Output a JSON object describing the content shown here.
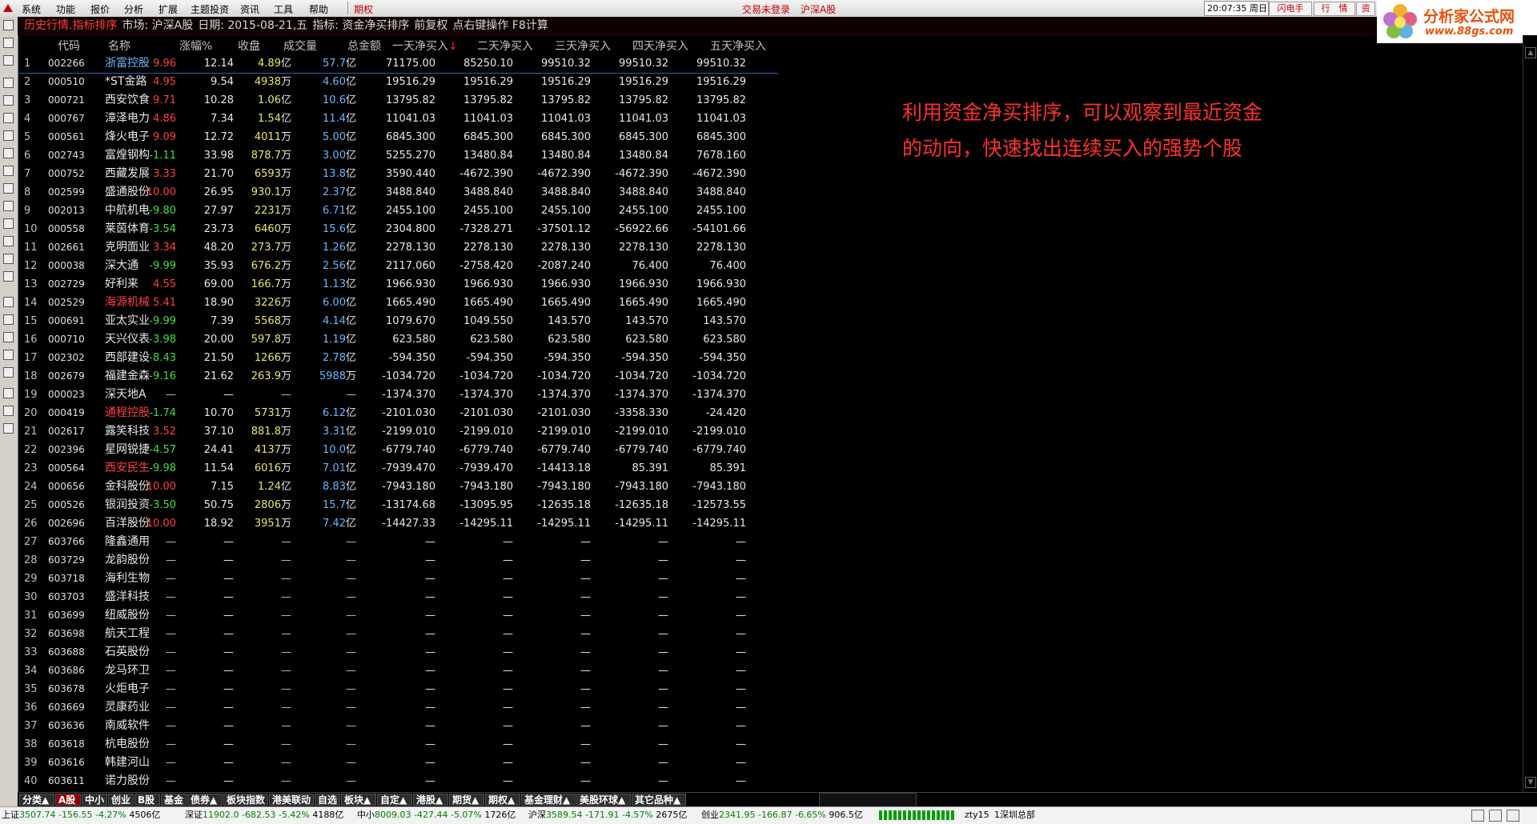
{
  "menu": {
    "items": [
      "系统",
      "功能",
      "报价",
      "分析",
      "扩展",
      "主题投资",
      "资讯",
      "工具",
      "帮助"
    ],
    "option_label": "期权",
    "login_status": "交易未登录",
    "market": "沪深A股",
    "clock": "20:07:35 周日",
    "buttons": [
      "闪电手",
      "行　情",
      "资"
    ]
  },
  "logo": {
    "title": "分析家公式网",
    "url": "www.88gs.com"
  },
  "info_bar": {
    "view_title": "历史行情.指标排序",
    "market": "市场: 沪深A股",
    "date": "日期: 2015-08-21,五",
    "indicator": "指标: 资金净买排序",
    "adjust": "前复权",
    "hint": "点右键操作 F8计算"
  },
  "table": {
    "headers": [
      "代码",
      "名称",
      "涨幅%",
      "收盘",
      "成交量",
      "总金额",
      "一天净买入",
      "二天净买入",
      "三天净买入",
      "四天净买入",
      "五天净买入"
    ],
    "sort_marker": "↓",
    "rows": [
      {
        "no": "1",
        "code": "002266",
        "name": "浙富控股",
        "name_color": "#68b8ff",
        "pct": "9.96",
        "pct_color": "#ff4040",
        "close": "12.14",
        "vol": "4.89",
        "vol_unit": "亿",
        "amt": "57.7",
        "amt_unit": "亿",
        "d1": "71175.00",
        "d2": "85250.10",
        "d3": "99510.32",
        "d4": "99510.32",
        "d5": "99510.32"
      },
      {
        "no": "2",
        "code": "000510",
        "name": "*ST金路",
        "name_color": "#e8e8e8",
        "pct": "4.95",
        "pct_color": "#ff4040",
        "close": "9.54",
        "vol": "4938",
        "vol_unit": "万",
        "amt": "4.60",
        "amt_unit": "亿",
        "d1": "19516.29",
        "d2": "19516.29",
        "d3": "19516.29",
        "d4": "19516.29",
        "d5": "19516.29"
      },
      {
        "no": "3",
        "code": "000721",
        "name": "西安饮食",
        "name_color": "#e8e8e8",
        "pct": "9.71",
        "pct_color": "#ff4040",
        "close": "10.28",
        "vol": "1.06",
        "vol_unit": "亿",
        "amt": "10.6",
        "amt_unit": "亿",
        "d1": "13795.82",
        "d2": "13795.82",
        "d3": "13795.82",
        "d4": "13795.82",
        "d5": "13795.82"
      },
      {
        "no": "4",
        "code": "000767",
        "name": "漳泽电力",
        "name_color": "#e8e8e8",
        "pct": "4.86",
        "pct_color": "#ff4040",
        "close": "7.34",
        "vol": "1.54",
        "vol_unit": "亿",
        "amt": "11.4",
        "amt_unit": "亿",
        "d1": "11041.03",
        "d2": "11041.03",
        "d3": "11041.03",
        "d4": "11041.03",
        "d5": "11041.03"
      },
      {
        "no": "5",
        "code": "000561",
        "name": "烽火电子",
        "name_color": "#e8e8e8",
        "pct": "9.09",
        "pct_color": "#ff4040",
        "close": "12.72",
        "vol": "4011",
        "vol_unit": "万",
        "amt": "5.00",
        "amt_unit": "亿",
        "d1": "6845.300",
        "d2": "6845.300",
        "d3": "6845.300",
        "d4": "6845.300",
        "d5": "6845.300"
      },
      {
        "no": "6",
        "code": "002743",
        "name": "富煌钢构",
        "name_color": "#e8e8e8",
        "pct": "-1.11",
        "pct_color": "#40e040",
        "close": "33.98",
        "vol": "878.7",
        "vol_unit": "万",
        "amt": "3.00",
        "amt_unit": "亿",
        "d1": "5255.270",
        "d2": "13480.84",
        "d3": "13480.84",
        "d4": "13480.84",
        "d5": "7678.160"
      },
      {
        "no": "7",
        "code": "000752",
        "name": "西藏发展",
        "name_color": "#e8e8e8",
        "pct": "3.33",
        "pct_color": "#ff4040",
        "close": "21.70",
        "vol": "6593",
        "vol_unit": "万",
        "amt": "13.8",
        "amt_unit": "亿",
        "d1": "3590.440",
        "d2": "-4672.390",
        "d3": "-4672.390",
        "d4": "-4672.390",
        "d5": "-4672.390"
      },
      {
        "no": "8",
        "code": "002599",
        "name": "盛通股份",
        "name_color": "#e8e8e8",
        "pct": "10.00",
        "pct_color": "#ff4040",
        "close": "26.95",
        "vol": "930.1",
        "vol_unit": "万",
        "amt": "2.37",
        "amt_unit": "亿",
        "d1": "3488.840",
        "d2": "3488.840",
        "d3": "3488.840",
        "d4": "3488.840",
        "d5": "3488.840"
      },
      {
        "no": "9",
        "code": "002013",
        "name": "中航机电",
        "name_color": "#e8e8e8",
        "pct": "-9.80",
        "pct_color": "#40e040",
        "close": "27.97",
        "vol": "2231",
        "vol_unit": "万",
        "amt": "6.71",
        "amt_unit": "亿",
        "d1": "2455.100",
        "d2": "2455.100",
        "d3": "2455.100",
        "d4": "2455.100",
        "d5": "2455.100"
      },
      {
        "no": "10",
        "code": "000558",
        "name": "莱茵体育",
        "name_color": "#e8e8e8",
        "pct": "-3.54",
        "pct_color": "#40e040",
        "close": "23.73",
        "vol": "6460",
        "vol_unit": "万",
        "amt": "15.6",
        "amt_unit": "亿",
        "d1": "2304.800",
        "d2": "-7328.271",
        "d3": "-37501.12",
        "d4": "-56922.66",
        "d5": "-54101.66"
      },
      {
        "no": "11",
        "code": "002661",
        "name": "克明面业",
        "name_color": "#e8e8e8",
        "pct": "3.34",
        "pct_color": "#ff4040",
        "close": "48.20",
        "vol": "273.7",
        "vol_unit": "万",
        "amt": "1.26",
        "amt_unit": "亿",
        "d1": "2278.130",
        "d2": "2278.130",
        "d3": "2278.130",
        "d4": "2278.130",
        "d5": "2278.130"
      },
      {
        "no": "12",
        "code": "000038",
        "name": "深大通",
        "name_color": "#e8e8e8",
        "pct": "-9.99",
        "pct_color": "#40e040",
        "close": "35.93",
        "vol": "676.2",
        "vol_unit": "万",
        "amt": "2.56",
        "amt_unit": "亿",
        "d1": "2117.060",
        "d2": "-2758.420",
        "d3": "-2087.240",
        "d4": "76.400",
        "d5": "76.400"
      },
      {
        "no": "13",
        "code": "002729",
        "name": "好利来",
        "name_color": "#e8e8e8",
        "pct": "4.55",
        "pct_color": "#ff4040",
        "close": "69.00",
        "vol": "166.7",
        "vol_unit": "万",
        "amt": "1.13",
        "amt_unit": "亿",
        "d1": "1966.930",
        "d2": "1966.930",
        "d3": "1966.930",
        "d4": "1966.930",
        "d5": "1966.930"
      },
      {
        "no": "14",
        "code": "002529",
        "name": "海源机械",
        "name_color": "#ff4040",
        "pct": "5.41",
        "pct_color": "#ff4040",
        "close": "18.90",
        "vol": "3226",
        "vol_unit": "万",
        "amt": "6.00",
        "amt_unit": "亿",
        "d1": "1665.490",
        "d2": "1665.490",
        "d3": "1665.490",
        "d4": "1665.490",
        "d5": "1665.490"
      },
      {
        "no": "15",
        "code": "000691",
        "name": "亚太实业",
        "name_color": "#e8e8e8",
        "pct": "-9.99",
        "pct_color": "#40e040",
        "close": "7.39",
        "vol": "5568",
        "vol_unit": "万",
        "amt": "4.14",
        "amt_unit": "亿",
        "d1": "1079.670",
        "d2": "1049.550",
        "d3": "143.570",
        "d4": "143.570",
        "d5": "143.570"
      },
      {
        "no": "16",
        "code": "000710",
        "name": "天兴仪表",
        "name_color": "#e8e8e8",
        "pct": "-3.98",
        "pct_color": "#40e040",
        "close": "20.00",
        "vol": "597.8",
        "vol_unit": "万",
        "amt": "1.19",
        "amt_unit": "亿",
        "d1": "623.580",
        "d2": "623.580",
        "d3": "623.580",
        "d4": "623.580",
        "d5": "623.580"
      },
      {
        "no": "17",
        "code": "002302",
        "name": "西部建设",
        "name_color": "#e8e8e8",
        "pct": "-8.43",
        "pct_color": "#40e040",
        "close": "21.50",
        "vol": "1266",
        "vol_unit": "万",
        "amt": "2.78",
        "amt_unit": "亿",
        "d1": "-594.350",
        "d2": "-594.350",
        "d3": "-594.350",
        "d4": "-594.350",
        "d5": "-594.350"
      },
      {
        "no": "18",
        "code": "002679",
        "name": "福建金森",
        "name_color": "#e8e8e8",
        "pct": "-9.16",
        "pct_color": "#40e040",
        "close": "21.62",
        "vol": "263.9",
        "vol_unit": "万",
        "amt": "5988",
        "amt_unit": "万",
        "d1": "-1034.720",
        "d2": "-1034.720",
        "d3": "-1034.720",
        "d4": "-1034.720",
        "d5": "-1034.720"
      },
      {
        "no": "19",
        "code": "000023",
        "name": "深天地A",
        "name_color": "#e8e8e8",
        "pct": "—",
        "pct_color": "#c0c0c0",
        "close": "—",
        "vol": "—",
        "vol_unit": "",
        "amt": "—",
        "amt_unit": "",
        "d1": "-1374.370",
        "d2": "-1374.370",
        "d3": "-1374.370",
        "d4": "-1374.370",
        "d5": "-1374.370"
      },
      {
        "no": "20",
        "code": "000419",
        "name": "通程控股",
        "name_color": "#ff4040",
        "pct": "-1.74",
        "pct_color": "#40e040",
        "close": "10.70",
        "vol": "5731",
        "vol_unit": "万",
        "amt": "6.12",
        "amt_unit": "亿",
        "d1": "-2101.030",
        "d2": "-2101.030",
        "d3": "-2101.030",
        "d4": "-3358.330",
        "d5": "-24.420"
      },
      {
        "no": "21",
        "code": "002617",
        "name": "露笑科技",
        "name_color": "#e8e8e8",
        "pct": "3.52",
        "pct_color": "#ff4040",
        "close": "37.10",
        "vol": "881.8",
        "vol_unit": "万",
        "amt": "3.31",
        "amt_unit": "亿",
        "d1": "-2199.010",
        "d2": "-2199.010",
        "d3": "-2199.010",
        "d4": "-2199.010",
        "d5": "-2199.010"
      },
      {
        "no": "22",
        "code": "002396",
        "name": "星网锐捷",
        "name_color": "#e8e8e8",
        "pct": "-4.57",
        "pct_color": "#40e040",
        "close": "24.41",
        "vol": "4137",
        "vol_unit": "万",
        "amt": "10.0",
        "amt_unit": "亿",
        "d1": "-6779.740",
        "d2": "-6779.740",
        "d3": "-6779.740",
        "d4": "-6779.740",
        "d5": "-6779.740"
      },
      {
        "no": "23",
        "code": "000564",
        "name": "西安民生",
        "name_color": "#ff4040",
        "pct": "-9.98",
        "pct_color": "#40e040",
        "close": "11.54",
        "vol": "6016",
        "vol_unit": "万",
        "amt": "7.01",
        "amt_unit": "亿",
        "d1": "-7939.470",
        "d2": "-7939.470",
        "d3": "-14413.18",
        "d4": "85.391",
        "d5": "85.391"
      },
      {
        "no": "24",
        "code": "000656",
        "name": "金科股份",
        "name_color": "#e8e8e8",
        "pct": "10.00",
        "pct_color": "#ff4040",
        "close": "7.15",
        "vol": "1.24",
        "vol_unit": "亿",
        "amt": "8.83",
        "amt_unit": "亿",
        "d1": "-7943.180",
        "d2": "-7943.180",
        "d3": "-7943.180",
        "d4": "-7943.180",
        "d5": "-7943.180"
      },
      {
        "no": "25",
        "code": "000526",
        "name": "银润投资",
        "name_color": "#e8e8e8",
        "pct": "-3.50",
        "pct_color": "#40e040",
        "close": "50.75",
        "vol": "2806",
        "vol_unit": "万",
        "amt": "15.7",
        "amt_unit": "亿",
        "d1": "-13174.68",
        "d2": "-13095.95",
        "d3": "-12635.18",
        "d4": "-12635.18",
        "d5": "-12573.55"
      },
      {
        "no": "26",
        "code": "002696",
        "name": "百洋股份",
        "name_color": "#e8e8e8",
        "pct": "10.00",
        "pct_color": "#ff4040",
        "close": "18.92",
        "vol": "3951",
        "vol_unit": "万",
        "amt": "7.42",
        "amt_unit": "亿",
        "d1": "-14427.33",
        "d2": "-14295.11",
        "d3": "-14295.11",
        "d4": "-14295.11",
        "d5": "-14295.11"
      },
      {
        "no": "27",
        "code": "603766",
        "name": "隆鑫通用",
        "name_color": "#e8e8e8",
        "pct": "—",
        "pct_color": "#c0c0c0",
        "close": "—",
        "vol": "—",
        "vol_unit": "",
        "amt": "—",
        "amt_unit": "",
        "d1": "—",
        "d2": "—",
        "d3": "—",
        "d4": "—",
        "d5": "—"
      },
      {
        "no": "28",
        "code": "603729",
        "name": "龙韵股份",
        "name_color": "#e8e8e8",
        "pct": "—",
        "pct_color": "#c0c0c0",
        "close": "—",
        "vol": "—",
        "vol_unit": "",
        "amt": "—",
        "amt_unit": "",
        "d1": "—",
        "d2": "—",
        "d3": "—",
        "d4": "—",
        "d5": "—"
      },
      {
        "no": "29",
        "code": "603718",
        "name": "海利生物",
        "name_color": "#e8e8e8",
        "pct": "—",
        "pct_color": "#c0c0c0",
        "close": "—",
        "vol": "—",
        "vol_unit": "",
        "amt": "—",
        "amt_unit": "",
        "d1": "—",
        "d2": "—",
        "d3": "—",
        "d4": "—",
        "d5": "—"
      },
      {
        "no": "30",
        "code": "603703",
        "name": "盛洋科技",
        "name_color": "#e8e8e8",
        "pct": "—",
        "pct_color": "#c0c0c0",
        "close": "—",
        "vol": "—",
        "vol_unit": "",
        "amt": "—",
        "amt_unit": "",
        "d1": "—",
        "d2": "—",
        "d3": "—",
        "d4": "—",
        "d5": "—"
      },
      {
        "no": "31",
        "code": "603699",
        "name": "纽威股份",
        "name_color": "#e8e8e8",
        "pct": "—",
        "pct_color": "#c0c0c0",
        "close": "—",
        "vol": "—",
        "vol_unit": "",
        "amt": "—",
        "amt_unit": "",
        "d1": "—",
        "d2": "—",
        "d3": "—",
        "d4": "—",
        "d5": "—"
      },
      {
        "no": "32",
        "code": "603698",
        "name": "航天工程",
        "name_color": "#e8e8e8",
        "pct": "—",
        "pct_color": "#c0c0c0",
        "close": "—",
        "vol": "—",
        "vol_unit": "",
        "amt": "—",
        "amt_unit": "",
        "d1": "—",
        "d2": "—",
        "d3": "—",
        "d4": "—",
        "d5": "—"
      },
      {
        "no": "33",
        "code": "603688",
        "name": "石英股份",
        "name_color": "#e8e8e8",
        "pct": "—",
        "pct_color": "#c0c0c0",
        "close": "—",
        "vol": "—",
        "vol_unit": "",
        "amt": "—",
        "amt_unit": "",
        "d1": "—",
        "d2": "—",
        "d3": "—",
        "d4": "—",
        "d5": "—"
      },
      {
        "no": "34",
        "code": "603686",
        "name": "龙马环卫",
        "name_color": "#e8e8e8",
        "pct": "—",
        "pct_color": "#c0c0c0",
        "close": "—",
        "vol": "—",
        "vol_unit": "",
        "amt": "—",
        "amt_unit": "",
        "d1": "—",
        "d2": "—",
        "d3": "—",
        "d4": "—",
        "d5": "—"
      },
      {
        "no": "35",
        "code": "603678",
        "name": "火炬电子",
        "name_color": "#e8e8e8",
        "pct": "—",
        "pct_color": "#c0c0c0",
        "close": "—",
        "vol": "—",
        "vol_unit": "",
        "amt": "—",
        "amt_unit": "",
        "d1": "—",
        "d2": "—",
        "d3": "—",
        "d4": "—",
        "d5": "—"
      },
      {
        "no": "36",
        "code": "603669",
        "name": "灵康药业",
        "name_color": "#e8e8e8",
        "pct": "—",
        "pct_color": "#c0c0c0",
        "close": "—",
        "vol": "—",
        "vol_unit": "",
        "amt": "—",
        "amt_unit": "",
        "d1": "—",
        "d2": "—",
        "d3": "—",
        "d4": "—",
        "d5": "—"
      },
      {
        "no": "37",
        "code": "603636",
        "name": "南威软件",
        "name_color": "#e8e8e8",
        "pct": "—",
        "pct_color": "#c0c0c0",
        "close": "—",
        "vol": "—",
        "vol_unit": "",
        "amt": "—",
        "amt_unit": "",
        "d1": "—",
        "d2": "—",
        "d3": "—",
        "d4": "—",
        "d5": "—"
      },
      {
        "no": "38",
        "code": "603618",
        "name": "杭电股份",
        "name_color": "#e8e8e8",
        "pct": "—",
        "pct_color": "#c0c0c0",
        "close": "—",
        "vol": "—",
        "vol_unit": "",
        "amt": "—",
        "amt_unit": "",
        "d1": "—",
        "d2": "—",
        "d3": "—",
        "d4": "—",
        "d5": "—"
      },
      {
        "no": "39",
        "code": "603616",
        "name": "韩建河山",
        "name_color": "#e8e8e8",
        "pct": "—",
        "pct_color": "#c0c0c0",
        "close": "—",
        "vol": "—",
        "vol_unit": "",
        "amt": "—",
        "amt_unit": "",
        "d1": "—",
        "d2": "—",
        "d3": "—",
        "d4": "—",
        "d5": "—"
      },
      {
        "no": "40",
        "code": "603611",
        "name": "诺力股份",
        "name_color": "#e8e8e8",
        "pct": "—",
        "pct_color": "#c0c0c0",
        "close": "—",
        "vol": "—",
        "vol_unit": "",
        "amt": "—",
        "amt_unit": "",
        "d1": "—",
        "d2": "—",
        "d3": "—",
        "d4": "—",
        "d5": "—"
      }
    ]
  },
  "annotation": "利用资金净买排序，可以观察到最近资金的动向，快速找出连续买入的强势个股",
  "tabs": [
    "分类▲",
    "A股",
    "中小",
    "创业",
    "B股",
    "基金",
    "债券▲",
    "板块指数",
    "港美联动",
    "自选",
    "板块▲",
    "自定▲",
    "港股▲",
    "期货▲",
    "期权▲",
    "基金理财▲",
    "美股环球▲",
    "其它品种▲"
  ],
  "active_tab": "A股",
  "status": {
    "sh": {
      "name": "上证",
      "index": "3507.74",
      "change": "-156.55",
      "pct": "-4.27%",
      "amount": "4506亿"
    },
    "sz": {
      "name": "深证",
      "index": "11902.0",
      "change": "-682.53",
      "pct": "-5.42%",
      "amount": "4188亿"
    },
    "zx": {
      "name": "中小",
      "index": "8009.03",
      "change": "-427.44",
      "pct": "-5.07%",
      "amount": "1726亿"
    },
    "hs": {
      "name": "沪深",
      "index": "3589.54",
      "change": "-171.91",
      "pct": "-4.57%",
      "amount": "2675亿"
    },
    "cy": {
      "name": "创业",
      "index": "2341.95",
      "change": "-166.87",
      "pct": "-6.65%",
      "amount": "906.5亿"
    },
    "user": "zty15",
    "server": "1深圳总部"
  },
  "colors": {
    "up": "#ff4040",
    "down": "#40e040",
    "accent": "#c00000",
    "volume": "#e8e868",
    "amount": "#68b8ff"
  }
}
